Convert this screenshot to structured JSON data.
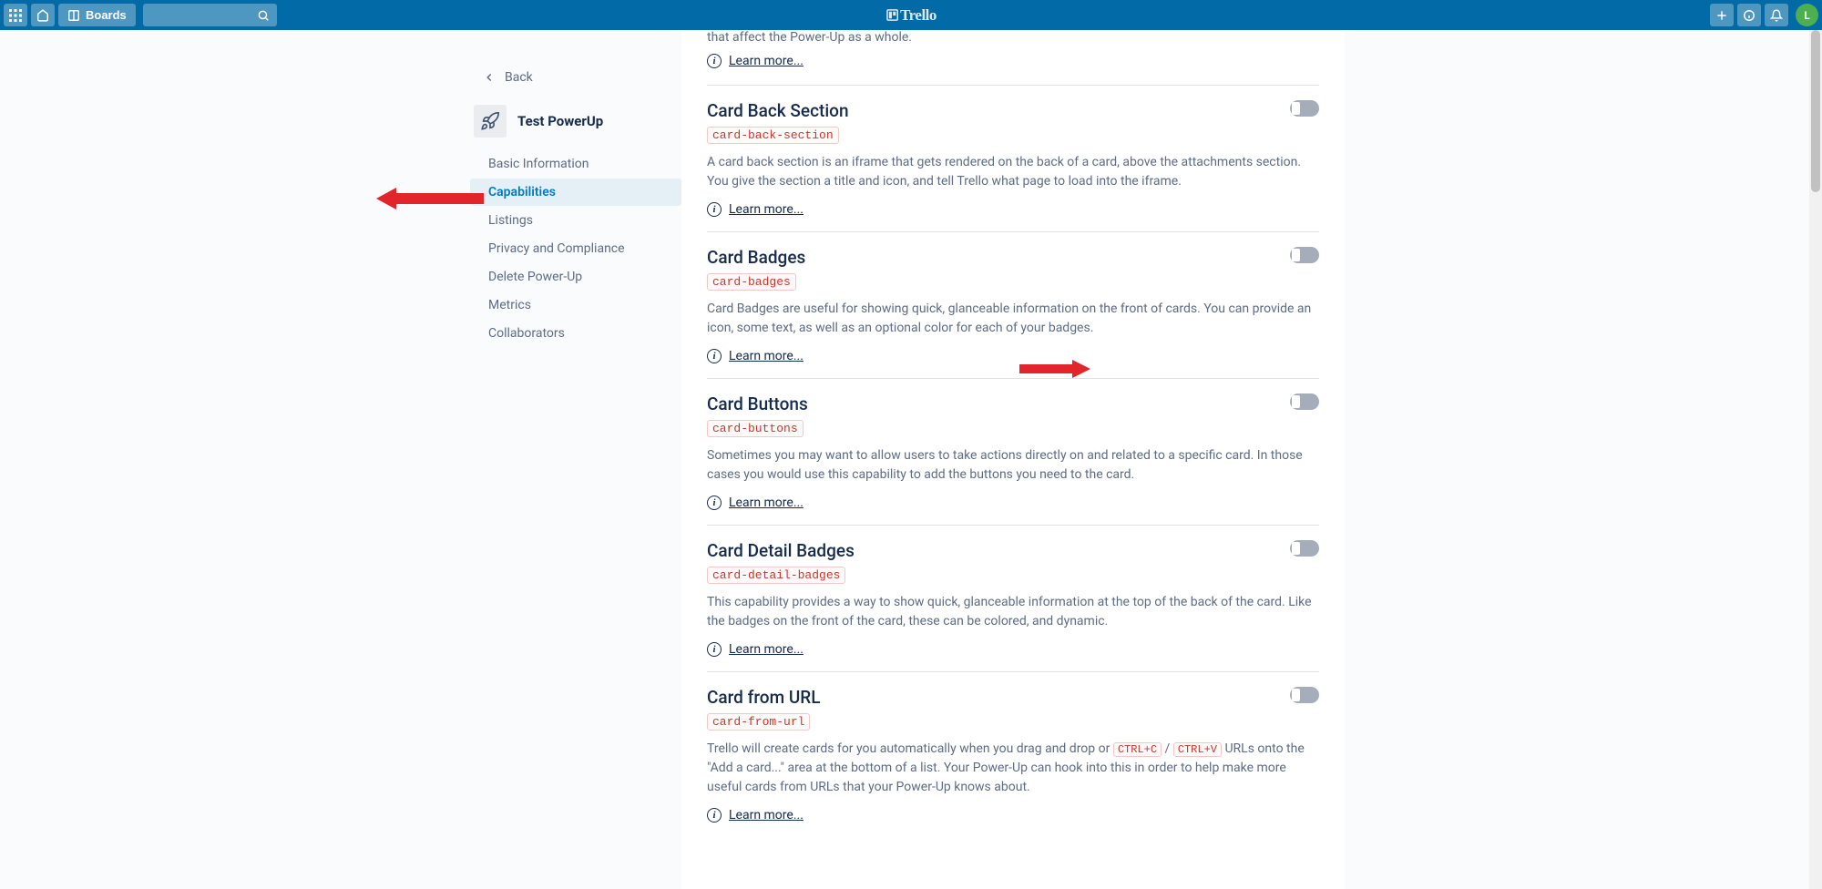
{
  "header": {
    "boards_label": "Boards",
    "brand": "Trello",
    "avatar_initial": "L"
  },
  "sidebar": {
    "back_label": "Back",
    "powerup_name": "Test PowerUp",
    "items": [
      {
        "label": "Basic Information"
      },
      {
        "label": "Capabilities"
      },
      {
        "label": "Listings"
      },
      {
        "label": "Privacy and Compliance"
      },
      {
        "label": "Delete Power-Up"
      },
      {
        "label": "Metrics"
      },
      {
        "label": "Collaborators"
      }
    ],
    "active_index": 1
  },
  "content": {
    "cut_top_text": "that affect the Power-Up as a whole.",
    "learn_more_label": "Learn more...",
    "capabilities": [
      {
        "title": "Card Back Section",
        "code": "card-back-section",
        "desc": "A card back section is an iframe that gets rendered on the back of a card, above the attachments section. You give the section a title and icon, and tell Trello what page to load into the iframe."
      },
      {
        "title": "Card Badges",
        "code": "card-badges",
        "desc": "Card Badges are useful for showing quick, glanceable information on the front of cards. You can provide an icon, some text, as well as an optional color for each of your badges."
      },
      {
        "title": "Card Buttons",
        "code": "card-buttons",
        "desc": "Sometimes you may want to allow users to take actions directly on and related to a specific card. In those cases you would use this capability to add the buttons you need to the card."
      },
      {
        "title": "Card Detail Badges",
        "code": "card-detail-badges",
        "desc": "This capability provides a way to show quick, glanceable information at the top of the back of the card. Like the badges on the front of the card, these can be colored, and dynamic."
      },
      {
        "title": "Card from URL",
        "code": "card-from-url",
        "desc_parts": {
          "p1": "Trello will create cards for you automatically when you drag and drop or ",
          "c1": "CTRL+C",
          "p2": " / ",
          "c2": "CTRL+V",
          "p3": " URLs onto the \"Add a card...\" area at the bottom of a list. Your Power-Up can hook into this in order to help make more useful cards from URLs that your Power-Up knows about."
        }
      }
    ]
  }
}
